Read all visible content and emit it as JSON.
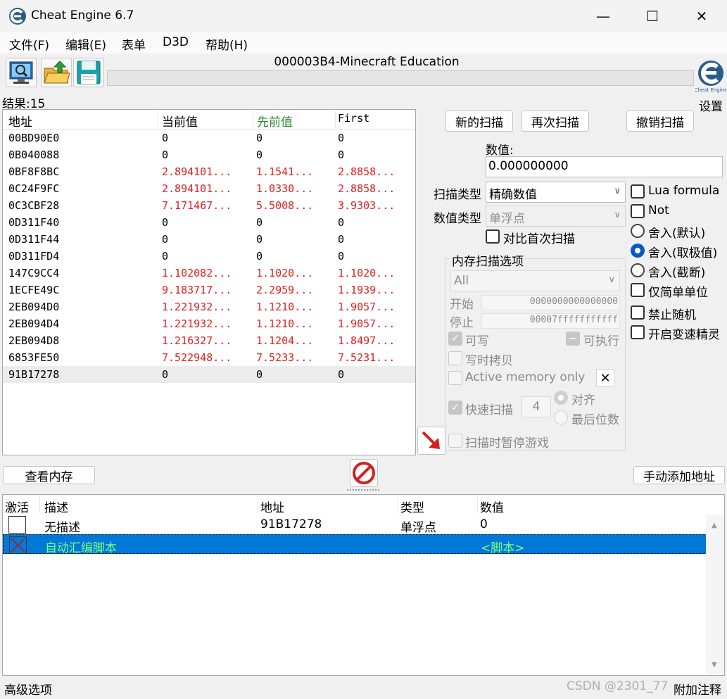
{
  "window": {
    "title": "Cheat Engine 6.7",
    "minimize": "—",
    "maximize": "☐",
    "close": "✕"
  },
  "menu": [
    "文件(F)",
    "编辑(E)",
    "表单",
    "D3D",
    "帮助(H)"
  ],
  "process_title": "000003B4-Minecraft Education",
  "settings_label": "设置",
  "results_label": "结果:15",
  "scan_table": {
    "headers": [
      "地址",
      "当前值",
      "先前值",
      "First"
    ],
    "header_colors": [
      "#000000",
      "#000000",
      "#2e8b2e",
      "#000000"
    ],
    "rows": [
      {
        "addr": "00BD90E0",
        "cur": "0",
        "prev": "0",
        "first": "0",
        "changed": false
      },
      {
        "addr": "0B040088",
        "cur": "0",
        "prev": "0",
        "first": "0",
        "changed": false
      },
      {
        "addr": "0BF8F8BC",
        "cur": "2.894101...",
        "prev": "1.1541...",
        "first": "2.8858...",
        "changed": true
      },
      {
        "addr": "0C24F9FC",
        "cur": "2.894101...",
        "prev": "1.0330...",
        "first": "2.8858...",
        "changed": true
      },
      {
        "addr": "0C3CBF28",
        "cur": "7.171467...",
        "prev": "5.5008...",
        "first": "3.9303...",
        "changed": true
      },
      {
        "addr": "0D311F40",
        "cur": "0",
        "prev": "0",
        "first": "0",
        "changed": false
      },
      {
        "addr": "0D311F44",
        "cur": "0",
        "prev": "0",
        "first": "0",
        "changed": false
      },
      {
        "addr": "0D311FD4",
        "cur": "0",
        "prev": "0",
        "first": "0",
        "changed": false
      },
      {
        "addr": "147C9CC4",
        "cur": "1.102082...",
        "prev": "1.1020...",
        "first": "1.1020...",
        "changed": true
      },
      {
        "addr": "1ECFE49C",
        "cur": "9.183717...",
        "prev": "2.2959...",
        "first": "1.1939...",
        "changed": true
      },
      {
        "addr": "2EB094D0",
        "cur": "1.221932...",
        "prev": "1.1210...",
        "first": "1.9057...",
        "changed": true
      },
      {
        "addr": "2EB094D4",
        "cur": "1.221932...",
        "prev": "1.1210...",
        "first": "1.9057...",
        "changed": true
      },
      {
        "addr": "2EB094D8",
        "cur": "1.216327...",
        "prev": "1.1204...",
        "first": "1.8497...",
        "changed": true
      },
      {
        "addr": "6853FE50",
        "cur": "7.522948...",
        "prev": "7.5233...",
        "first": "7.5231...",
        "changed": true
      },
      {
        "addr": "91B17278",
        "cur": "0",
        "prev": "0",
        "first": "0",
        "changed": false,
        "selected": true
      }
    ]
  },
  "buttons": {
    "new_scan": "新的扫描",
    "next_scan": "再次扫描",
    "undo_scan": "撤销扫描",
    "view_memory": "查看内存",
    "add_address": "手动添加地址"
  },
  "value_label": "数值:",
  "value_input": "0.000000000",
  "scan_type_label": "扫描类型",
  "scan_type_value": "精确数值",
  "value_type_label": "数值类型",
  "value_type_value": "单浮点",
  "compare_first": "对比首次扫描",
  "options_right": {
    "lua_formula": "Lua formula",
    "not": "Not",
    "round_default": "舍入(默认)",
    "round_extreme": "舍入(取极值)",
    "round_truncate": "舍入(截断)",
    "simple_unit": "仅简单单位",
    "disable_random": "禁止随机",
    "speedhack": "开启变速精灵"
  },
  "mem_options": {
    "title": "内存扫描选项",
    "region": "All",
    "start_label": "开始",
    "start_value": "0000000000000000",
    "stop_label": "停止",
    "stop_value": "00007fffffffffff",
    "writable": "可写",
    "executable": "可执行",
    "copy_on_write": "写时拷贝",
    "active_memory": "Active memory only",
    "fast_scan": "快速扫描",
    "fast_scan_value": "4",
    "align": "对齐",
    "last_digits": "最后位数",
    "pause_game": "扫描时暂停游戏"
  },
  "cheat_table": {
    "headers": [
      "激活",
      "描述",
      "地址",
      "类型",
      "数值"
    ],
    "rows": [
      {
        "desc": "无描述",
        "addr": "91B17278",
        "type": "单浮点",
        "value": "0"
      },
      {
        "desc": "自动汇编脚本",
        "addr": "",
        "type": "",
        "value": "<脚本>"
      }
    ]
  },
  "status": {
    "left": "高级选项",
    "right": "附加注释",
    "watermark": "CSDN @2301_77"
  },
  "colors": {
    "selection": "#0078d7",
    "script_text": "#7dff7d",
    "changed": "#e02020"
  }
}
